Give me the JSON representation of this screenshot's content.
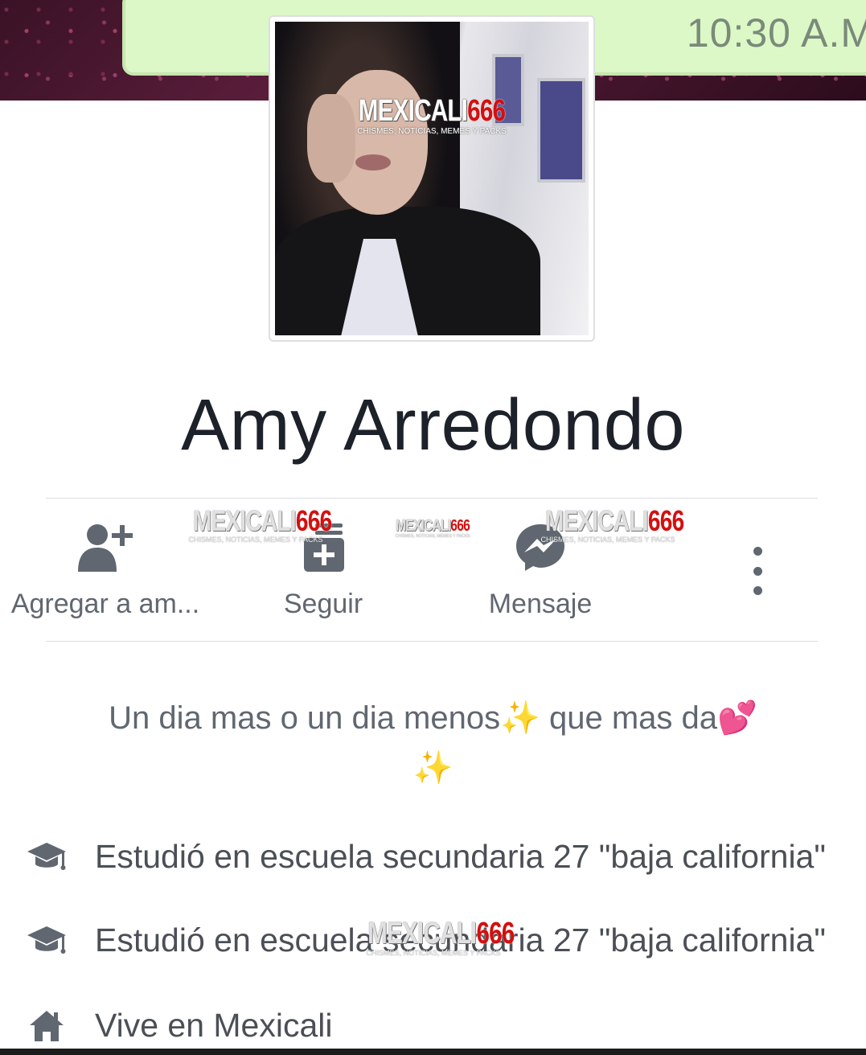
{
  "cover": {
    "time": "10:30 A.M"
  },
  "watermark": {
    "brand_a": "MEXICALI",
    "brand_b": "666",
    "tagline": "CHISMES, NOTICIAS, MEMES Y PACKS"
  },
  "profile": {
    "name": "Amy Arredondo"
  },
  "actions": [
    {
      "label": "Agregar a am...",
      "icon": "add-friend-icon"
    },
    {
      "label": "Seguir",
      "icon": "follow-icon"
    },
    {
      "label": "Mensaje",
      "icon": "messenger-icon"
    }
  ],
  "more": {
    "icon": "more-vertical-icon"
  },
  "bio": {
    "line1": "Un dia mas o un dia menos✨ que mas da💕",
    "line2": "✨"
  },
  "info": [
    {
      "icon": "graduation-cap-icon",
      "text": "Estudió en escuela secundaria 27 \"baja california\""
    },
    {
      "icon": "graduation-cap-icon",
      "text": "Estudió en escuela secundaria 27 \"baja california\""
    },
    {
      "icon": "home-icon",
      "text": "Vive en Mexicali"
    }
  ],
  "colors": {
    "icon_gray": "#606770",
    "name_text": "#1d2129",
    "divider": "#dadde1",
    "watermark_red": "#d40f0f"
  }
}
